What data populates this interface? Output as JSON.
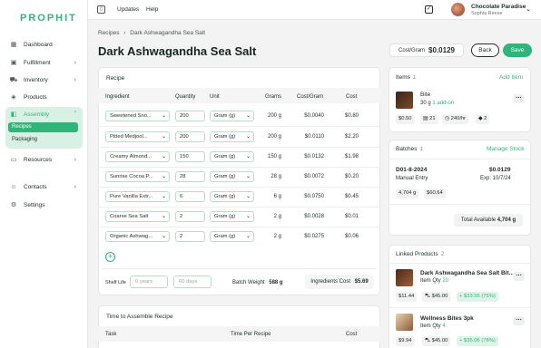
{
  "sidebar": {
    "logo": "PROPHIT",
    "items": [
      {
        "label": "Dashboard",
        "icon": "grid-icon"
      },
      {
        "label": "Fulfillment",
        "icon": "box-icon"
      },
      {
        "label": "Inventory",
        "icon": "truck-icon"
      },
      {
        "label": "Products",
        "icon": "tag-icon"
      },
      {
        "label": "Assembly",
        "icon": "layers-icon",
        "sub": [
          "Recipes",
          "Packaging"
        ]
      },
      {
        "label": "Resources",
        "icon": "folder-icon"
      },
      {
        "label": "Contacts",
        "icon": "contacts-icon"
      },
      {
        "label": "Settings",
        "icon": "gear-icon"
      }
    ]
  },
  "topbar": {
    "links": [
      "Updates",
      "Help"
    ],
    "account_name": "Chocolate Paradise",
    "account_user": "Sophia Reese"
  },
  "breadcrumb": {
    "root": "Recipes",
    "sep": "›",
    "current": "Dark Ashwagandha Sea Salt"
  },
  "page": {
    "title": "Dark Ashwagandha Sea Salt",
    "cost_label": "Cost/Gram",
    "cost_value": "$0.0129",
    "back": "Back",
    "save": "Save"
  },
  "recipe": {
    "title": "Recipe",
    "headers": [
      "Ingredient",
      "Quantity",
      "Unit",
      "Grams",
      "Cost/Gram",
      "Cost"
    ],
    "rows": [
      {
        "ingredient": "Sweetened Sno...",
        "qty": "200",
        "unit": "Gram (g)",
        "grams": "200 g",
        "cpg": "$0.0040",
        "cost": "$0.80"
      },
      {
        "ingredient": "Pitted Medjool...",
        "qty": "200",
        "unit": "Gram (g)",
        "grams": "200 g",
        "cpg": "$0.0110",
        "cost": "$2.20"
      },
      {
        "ingredient": "Creamy Almond...",
        "qty": "150",
        "unit": "Gram (g)",
        "grams": "150 g",
        "cpg": "$0.0132",
        "cost": "$1.98"
      },
      {
        "ingredient": "Sunrise Cocoa P...",
        "qty": "28",
        "unit": "Gram (g)",
        "grams": "28 g",
        "cpg": "$0.0072",
        "cost": "$0.20"
      },
      {
        "ingredient": "Pure Vanilla Extr...",
        "qty": "6",
        "unit": "Gram (g)",
        "grams": "6 g",
        "cpg": "$0.0750",
        "cost": "$0.45"
      },
      {
        "ingredient": "Coarse Sea Salt",
        "qty": "2",
        "unit": "Gram (g)",
        "grams": "2 g",
        "cpg": "$0.0028",
        "cost": "$0.01"
      },
      {
        "ingredient": "Organic Ashwag...",
        "qty": "2",
        "unit": "Gram (g)",
        "grams": "2 g",
        "cpg": "$0.0275",
        "cost": "$0.06"
      }
    ],
    "shelf_life_label": "Shelf Life",
    "years_placeholder": "0 years",
    "days_placeholder": "60 days",
    "batch_weight_label": "Batch Weight",
    "batch_weight_value": "588 g",
    "ingredients_cost_label": "Ingredients Cost",
    "ingredients_cost_value": "$5.69"
  },
  "time_card": {
    "title": "Time to Assemble Recipe",
    "headers": [
      "Task",
      "Time Per Recipe",
      "Cost"
    ]
  },
  "items_card": {
    "title": "Items",
    "count": "1",
    "add_label": "Add Item",
    "item": {
      "name": "Bite",
      "detail": "30 g",
      "addon": "1 add-on",
      "price": "$0.50",
      "qty": "21",
      "rate": "240/hr",
      "variants": "2"
    }
  },
  "batches_card": {
    "title": "Batches",
    "count": "1",
    "manage_label": "Manage Stock",
    "batch": {
      "id": "D01-8-2024",
      "source": "Manual Entry",
      "cost": "$0.0129",
      "exp": "Exp: 10/7/24",
      "weight": "4,704 g",
      "value": "$60.64"
    },
    "total_label": "Total Available",
    "total_value": "4,704 g"
  },
  "linked_card": {
    "title": "Linked Products",
    "count": "2",
    "products": [
      {
        "name": "Dark Ashwagandha Sea Salt Bit...",
        "qty_label": "Item Qty",
        "qty": "20",
        "price": "$11.44",
        "retail": "$45.00",
        "margin": "+ $33.56 (75%)"
      },
      {
        "name": "Wellness Bites 3pk",
        "qty_label": "Item Qty",
        "qty": "4",
        "price": "$9.94",
        "retail": "$45.00",
        "margin": "+ $35.06 (78%)"
      }
    ]
  },
  "colors": {
    "accent": "#2fb57a",
    "accent_light": "#d9f1e4"
  }
}
